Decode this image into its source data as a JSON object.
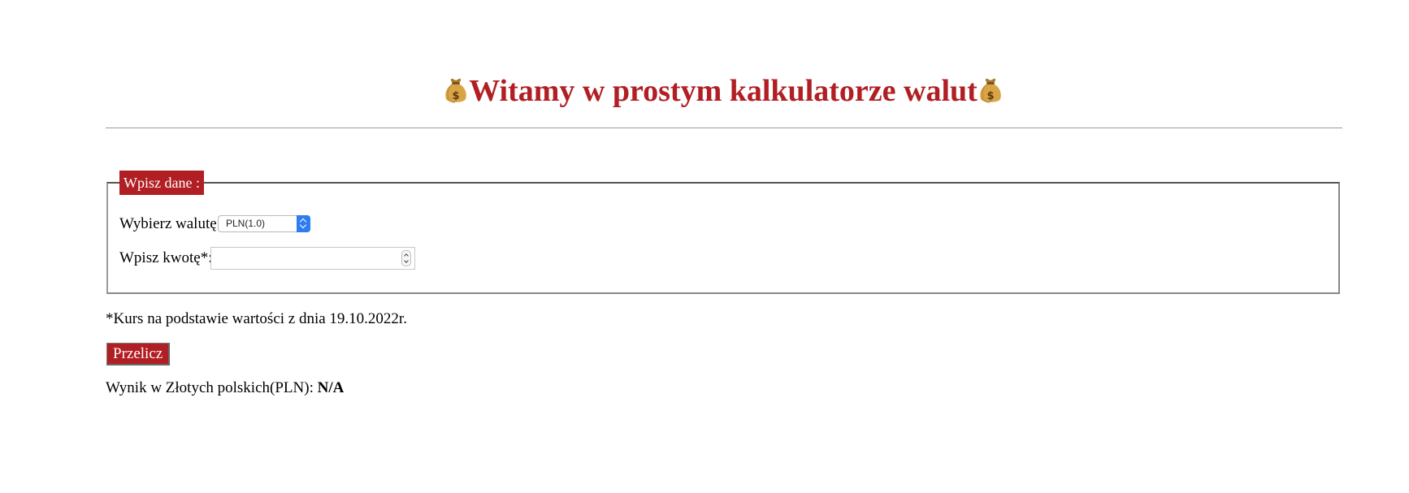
{
  "header": {
    "title": "Witamy w prostym kalkulatorze walut",
    "icon": "money-bag-icon"
  },
  "form": {
    "legend": "Wpisz dane :",
    "currency_label": "Wybierz walutę:",
    "currency_value": "PLN(1.0)",
    "amount_label": "Wpisz kwotę*:",
    "amount_value": "",
    "accent_color": "#b11e23",
    "select_accent": "#2d7cf0"
  },
  "note": "*Kurs na podstawie wartości z dnia 19.10.2022r.",
  "actions": {
    "convert_label": "Przelicz"
  },
  "result": {
    "label": "Wynik w Złotych polskich(PLN):",
    "value": "N/A"
  }
}
